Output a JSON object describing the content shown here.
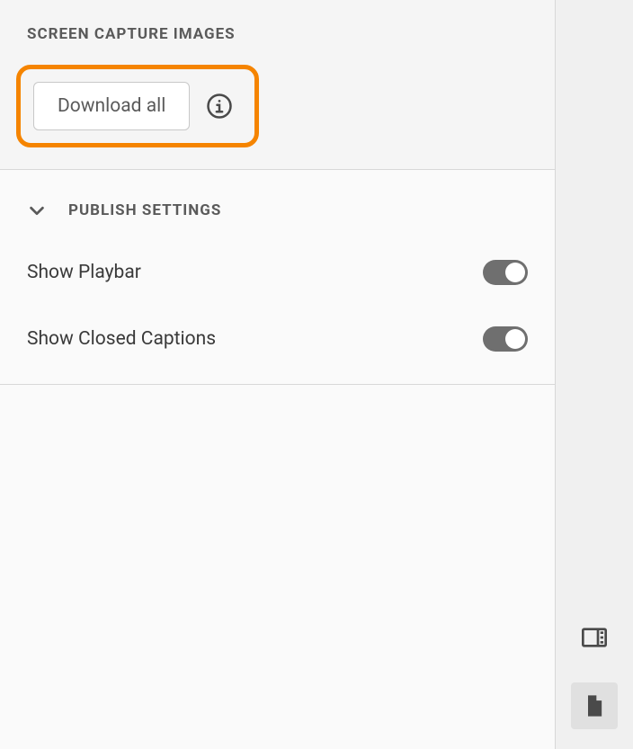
{
  "screenCapture": {
    "title": "SCREEN CAPTURE IMAGES",
    "downloadLabel": "Download all"
  },
  "publish": {
    "title": "PUBLISH SETTINGS",
    "playbar": {
      "label": "Show Playbar",
      "on": true
    },
    "captions": {
      "label": "Show Closed Captions",
      "on": true
    }
  }
}
